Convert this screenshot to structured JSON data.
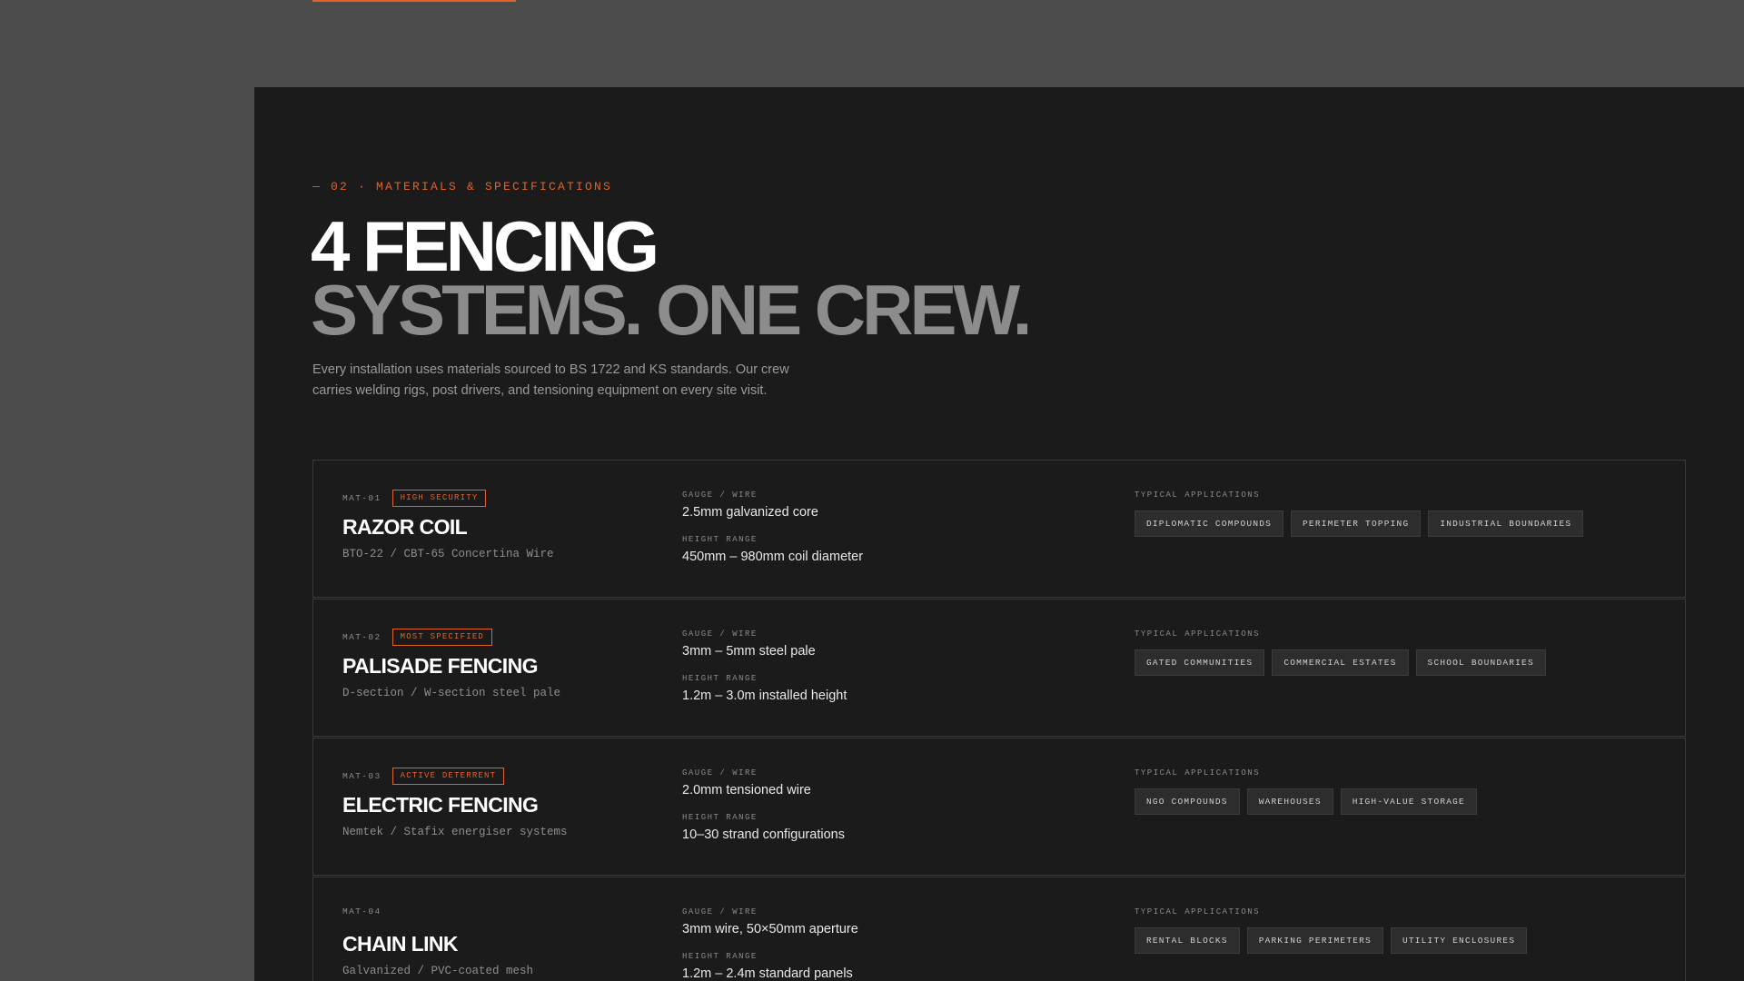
{
  "section": {
    "eyebrow": "— 02 · MATERIALS & SPECIFICATIONS",
    "headline_line1": "4 FENCING",
    "headline_line2": "SYSTEMS. ONE CREW.",
    "intro": "Every installation uses materials sourced to BS 1722 and KS standards. Our crew carries welding rigs, post drivers, and tensioning equipment on every site visit."
  },
  "labels": {
    "gauge": "GAUGE / WIRE",
    "height": "HEIGHT RANGE",
    "applications": "TYPICAL APPLICATIONS"
  },
  "materials": [
    {
      "code": "MAT-01",
      "badge": "HIGH SECURITY",
      "name": "RAZOR COIL",
      "subtitle": "BTO-22 / CBT-65 Concertina Wire",
      "gauge": "2.5mm galvanized core",
      "height": "450mm – 980mm coil diameter",
      "applications": [
        "DIPLOMATIC COMPOUNDS",
        "PERIMETER TOPPING",
        "INDUSTRIAL BOUNDARIES"
      ]
    },
    {
      "code": "MAT-02",
      "badge": "MOST SPECIFIED",
      "name": "PALISADE FENCING",
      "subtitle": "D-section / W-section steel pale",
      "gauge": "3mm – 5mm steel pale",
      "height": "1.2m – 3.0m installed height",
      "applications": [
        "GATED COMMUNITIES",
        "COMMERCIAL ESTATES",
        "SCHOOL BOUNDARIES"
      ]
    },
    {
      "code": "MAT-03",
      "badge": "ACTIVE DETERRENT",
      "name": "ELECTRIC FENCING",
      "subtitle": "Nemtek / Stafix energiser systems",
      "gauge": "2.0mm tensioned wire",
      "height": "10–30 strand configurations",
      "applications": [
        "NGO COMPOUNDS",
        "WAREHOUSES",
        "HIGH-VALUE STORAGE"
      ]
    },
    {
      "code": "MAT-04",
      "badge": "",
      "name": "CHAIN LINK",
      "subtitle": "Galvanized / PVC-coated mesh",
      "gauge": "3mm wire, 50×50mm aperture",
      "height": "1.2m – 2.4m standard panels",
      "applications": [
        "RENTAL BLOCKS",
        "PARKING PERIMETERS",
        "UTILITY ENCLOSURES"
      ]
    }
  ],
  "colors": {
    "accent": "#e2632a",
    "panel": "#1b1b1b",
    "backdrop": "#4b4b4b"
  }
}
